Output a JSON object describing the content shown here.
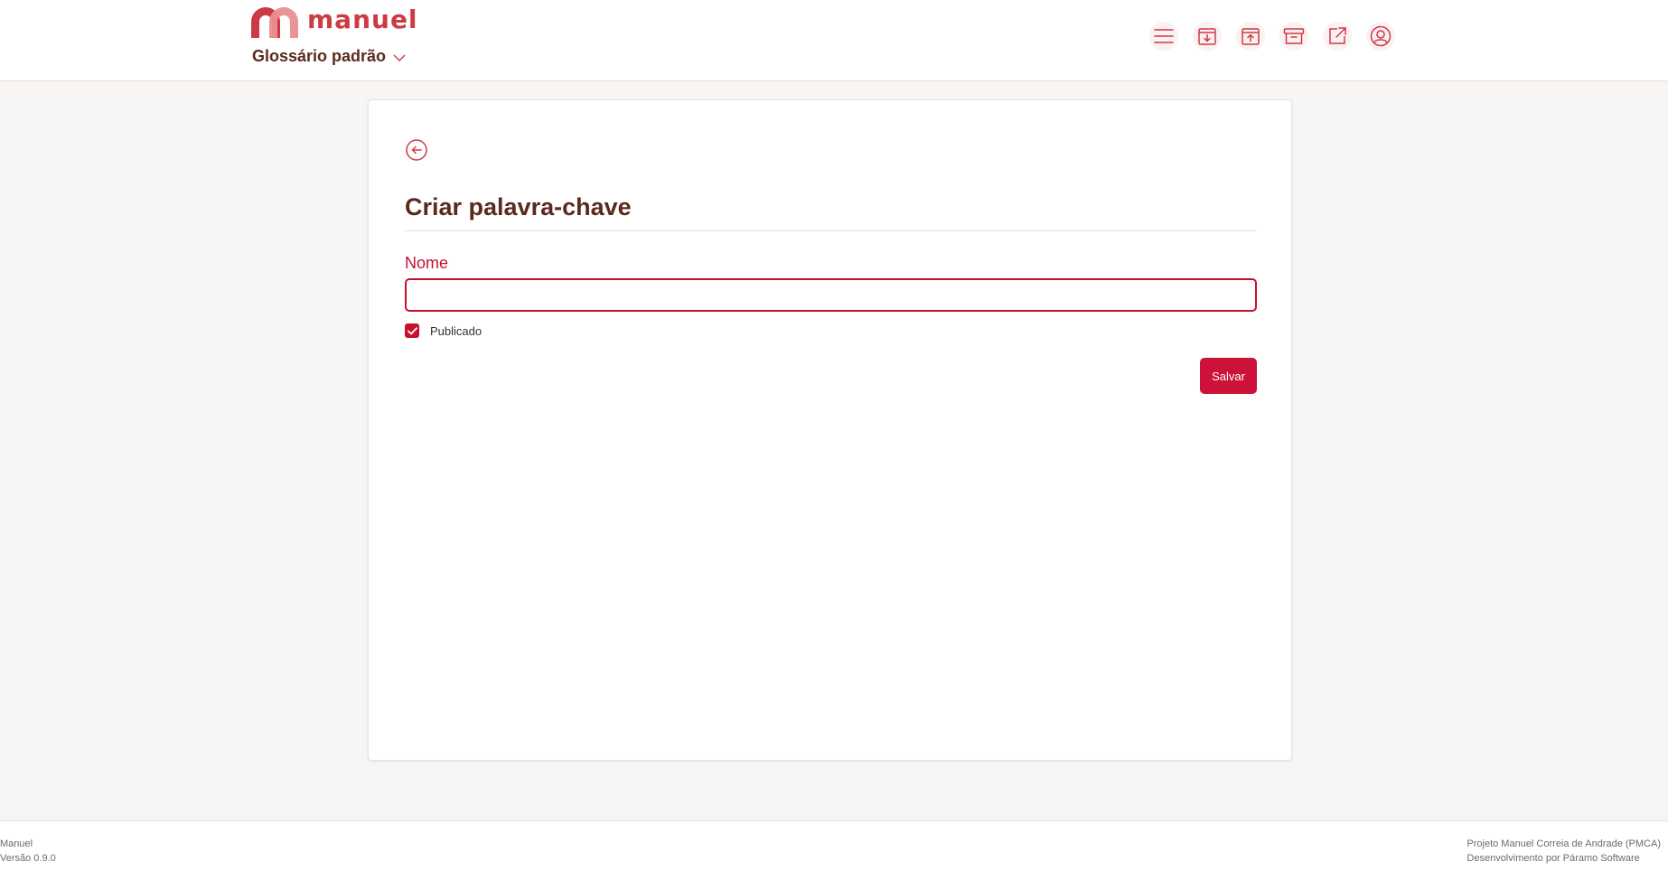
{
  "brand": {
    "name": "manuel",
    "accent": "#cc3a44",
    "primary": "#c8102e",
    "dark_text": "#5a2a1e"
  },
  "header": {
    "glossary_select": "Glossário padrão",
    "toolbar": [
      {
        "icon": "menu-icon"
      },
      {
        "icon": "archive-download-icon"
      },
      {
        "icon": "archive-upload-icon"
      },
      {
        "icon": "archive-box-icon"
      },
      {
        "icon": "external-link-icon"
      },
      {
        "icon": "user-account-icon"
      }
    ]
  },
  "form": {
    "title": "Criar palavra-chave",
    "name_label": "Nome",
    "name_value": "",
    "published_label": "Publicado",
    "published_checked": true,
    "save_label": "Salvar"
  },
  "footer": {
    "app_name": "Manuel",
    "version": "Versão 0.9.0",
    "project": "Projeto Manuel Correia de Andrade (PMCA)",
    "developer": "Desenvolvimento por Páramo Software"
  }
}
